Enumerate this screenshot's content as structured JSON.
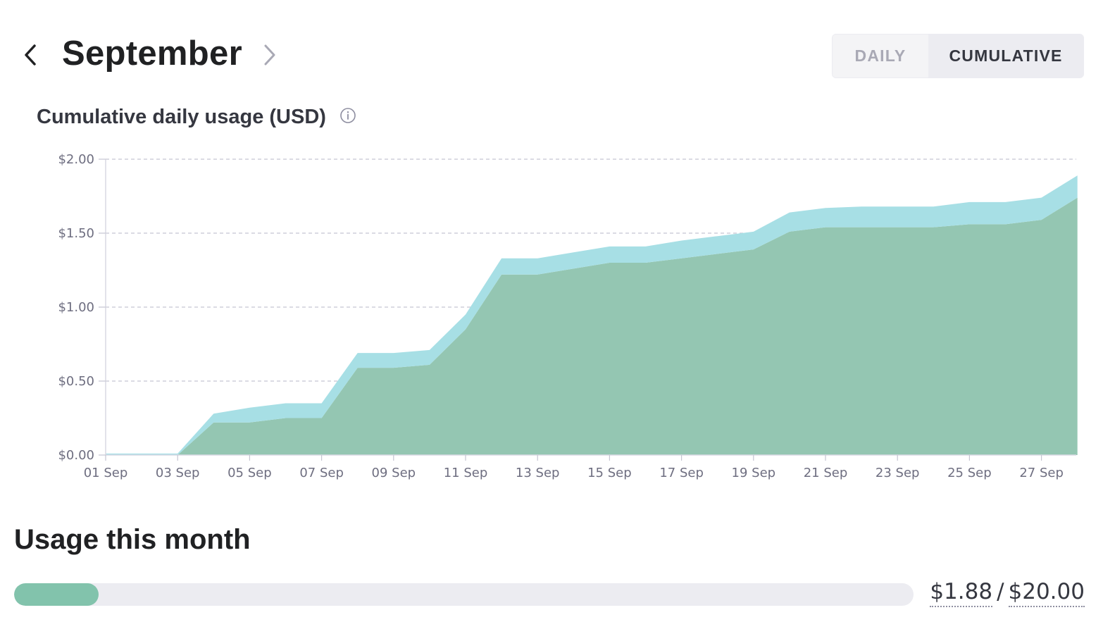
{
  "header": {
    "month": "September",
    "prev_icon": "chevron-left-icon",
    "next_icon": "chevron-right-icon"
  },
  "toggle": {
    "daily_label": "DAILY",
    "cumulative_label": "CUMULATIVE",
    "selected": "CUMULATIVE"
  },
  "chart_section": {
    "title": "Cumulative daily usage (USD)",
    "info_icon": "info-icon"
  },
  "chart_data": {
    "type": "area",
    "stacked": true,
    "title": "Cumulative daily usage (USD)",
    "xlabel": "",
    "ylabel": "",
    "ylim": [
      0,
      2
    ],
    "y_ticks": [
      "$0.00",
      "$0.50",
      "$1.00",
      "$1.50",
      "$2.00"
    ],
    "y_tick_values": [
      0,
      0.5,
      1,
      1.5,
      2
    ],
    "x_ticks": [
      "01 Sep",
      "03 Sep",
      "05 Sep",
      "07 Sep",
      "09 Sep",
      "11 Sep",
      "13 Sep",
      "15 Sep",
      "17 Sep",
      "19 Sep",
      "21 Sep",
      "23 Sep",
      "25 Sep",
      "27 Sep"
    ],
    "grid": "horizontal-dashed",
    "x": [
      "01 Sep",
      "02 Sep",
      "03 Sep",
      "04 Sep",
      "05 Sep",
      "06 Sep",
      "07 Sep",
      "08 Sep",
      "09 Sep",
      "10 Sep",
      "11 Sep",
      "12 Sep",
      "13 Sep",
      "14 Sep",
      "15 Sep",
      "16 Sep",
      "17 Sep",
      "18 Sep",
      "19 Sep",
      "20 Sep",
      "21 Sep",
      "22 Sep",
      "23 Sep",
      "24 Sep",
      "25 Sep",
      "26 Sep",
      "27 Sep",
      "28 Sep"
    ],
    "series": [
      {
        "color": "#94c6b2",
        "values": [
          0,
          0,
          0,
          0.22,
          0.22,
          0.25,
          0.25,
          0.59,
          0.59,
          0.61,
          0.85,
          1.22,
          1.22,
          1.26,
          1.3,
          1.3,
          1.33,
          1.36,
          1.39,
          1.51,
          1.54,
          1.54,
          1.54,
          1.54,
          1.56,
          1.56,
          1.59,
          1.74
        ]
      },
      {
        "color": "#a7dfe5",
        "values": [
          0.01,
          0.01,
          0.01,
          0.06,
          0.1,
          0.1,
          0.1,
          0.1,
          0.1,
          0.1,
          0.1,
          0.11,
          0.11,
          0.11,
          0.11,
          0.11,
          0.12,
          0.12,
          0.12,
          0.13,
          0.13,
          0.14,
          0.14,
          0.14,
          0.15,
          0.15,
          0.15,
          0.15
        ]
      }
    ]
  },
  "usage": {
    "title": "Usage this month",
    "amount": "$1.88",
    "separator": "/",
    "limit": "$20.00",
    "fraction": 0.094,
    "fill_color": "#82c3ac"
  }
}
